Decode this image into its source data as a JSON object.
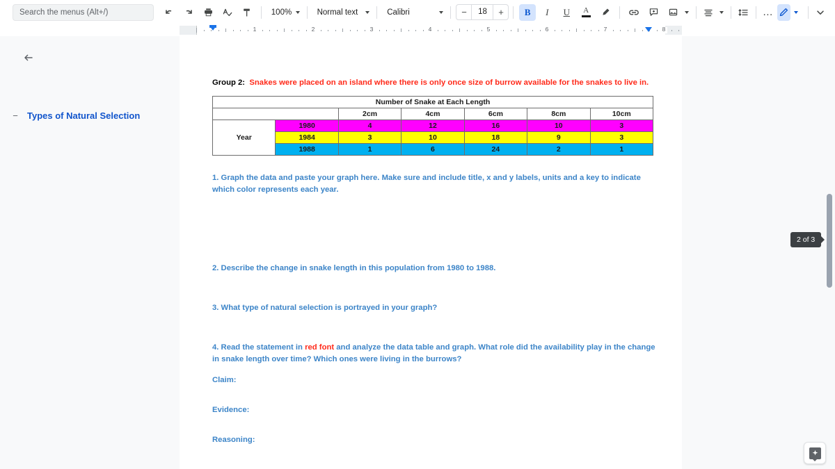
{
  "toolbar": {
    "search_placeholder": "Search the menus (Alt+/)",
    "zoom": "100%",
    "paragraph_style": "Normal text",
    "font": "Calibri",
    "font_size": "18",
    "minus": "−",
    "plus": "+",
    "bold_label": "B",
    "italic_label": "I",
    "underline_label": "U",
    "text_color_label": "A",
    "more_label": "…",
    "icons": {
      "undo": "undo-icon",
      "redo": "redo-icon",
      "print": "print-icon",
      "spellcheck": "spellcheck-icon",
      "paint_format": "paint-format-icon",
      "highlight": "highlight-pen-icon",
      "link": "link-icon",
      "comment": "add-comment-icon",
      "image": "insert-image-icon",
      "align": "align-icon",
      "line_spacing": "line-spacing-icon",
      "editing_mode": "pencil-editing-icon",
      "collapse": "chevron-down-icon"
    }
  },
  "ruler": {
    "numbers": [
      "1",
      "2",
      "3",
      "4",
      "5",
      "6",
      "7",
      "8"
    ]
  },
  "outline": {
    "back_label": "back-arrow",
    "items": [
      {
        "collapse": "−",
        "label": "Types of Natural Selection"
      }
    ]
  },
  "document": {
    "group_label": "Group 2:",
    "group_text": "Snakes were placed on an island where there is only once size of burrow available for the snakes to live in.",
    "table": {
      "title": "Number of Snake at Each Length",
      "row_header": "Year",
      "columns": [
        "2cm",
        "4cm",
        "6cm",
        "8cm",
        "10cm"
      ],
      "rows": [
        {
          "year": "1980",
          "color": "#ff00ff",
          "values": [
            "4",
            "12",
            "16",
            "10",
            "3"
          ]
        },
        {
          "year": "1984",
          "color": "#ffff00",
          "values": [
            "3",
            "10",
            "18",
            "9",
            "3"
          ]
        },
        {
          "year": "1988",
          "color": "#00b0f0",
          "values": [
            "1",
            "6",
            "24",
            "2",
            "1"
          ]
        }
      ]
    },
    "questions": {
      "q1": "1.  Graph the data and paste your graph here.  Make sure and include title, x and y labels, units and a key to indicate which color represents each year.",
      "q2": "2.  Describe the change in snake length in this population from 1980 to 1988.",
      "q3": "3.  What type of natural selection is portrayed in your graph?",
      "q4_a": "4.  Read the statement in ",
      "q4_red": "red font",
      "q4_b": " and analyze the data table and graph.  What role did the availability play in the change in snake length over time?  Which ones were living in the burrows?"
    },
    "cer": {
      "claim": "Claim:",
      "evidence": "Evidence:",
      "reasoning": "Reasoning:"
    }
  },
  "status": {
    "page_indicator": "2 of 3"
  },
  "colors": {
    "accent": "#0b57d0",
    "outline_link": "#1155cc",
    "question_blue": "#3d85c8",
    "red": "#ff2a1a"
  }
}
